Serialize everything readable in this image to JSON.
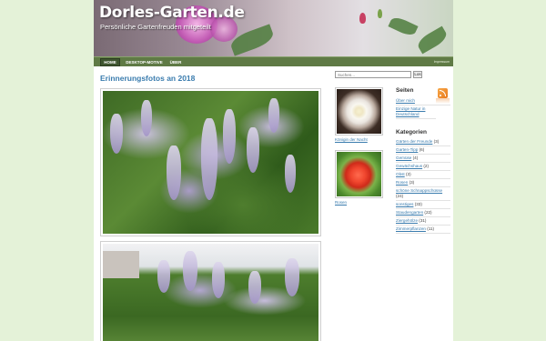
{
  "header": {
    "title": "Dorles-Garten.de",
    "tagline": "Persönliche Gartenfreuden mitgeteilt"
  },
  "nav": {
    "items": [
      {
        "label": "HOME",
        "active": true
      },
      {
        "label": "DESKTOP-MOTIVE",
        "active": false
      },
      {
        "label": "ÜBER",
        "active": false
      }
    ],
    "impressum": "Impressum"
  },
  "post": {
    "title": "Erinnerungsfotos an 2018"
  },
  "search": {
    "placeholder": "Suchen...",
    "button_label": "Los"
  },
  "sidebar_images": [
    {
      "caption": "Königin der Nacht"
    },
    {
      "caption": "Rosen"
    }
  ],
  "pages_widget": {
    "heading": "Seiten",
    "links": [
      {
        "label": "Über mich"
      },
      {
        "label": "Einzige Natur in Deutschland"
      }
    ]
  },
  "categories_widget": {
    "heading": "Kategorien",
    "items": [
      {
        "label": "Gärten der Freunde",
        "count": "(3)"
      },
      {
        "label": "Garten-Tipp",
        "count": "(6)"
      },
      {
        "label": "Gemüse",
        "count": "(4)"
      },
      {
        "label": "Gewächshaus",
        "count": "(2)"
      },
      {
        "label": "Obst",
        "count": "(3)"
      },
      {
        "label": "Rosen",
        "count": "(3)"
      },
      {
        "label": "schöne Schnappschüsse",
        "count": "(24)"
      },
      {
        "label": "sonstiges",
        "count": "(33)"
      },
      {
        "label": "Staudengarten",
        "count": "(22)"
      },
      {
        "label": "Ziergehölze",
        "count": "(31)"
      },
      {
        "label": "Zimmerpflanzen",
        "count": "(11)"
      }
    ]
  },
  "colors": {
    "background": "#e4f2d8",
    "nav_bar": "#5f7a45",
    "link": "#3a7cae",
    "rss": "#e8791b"
  }
}
